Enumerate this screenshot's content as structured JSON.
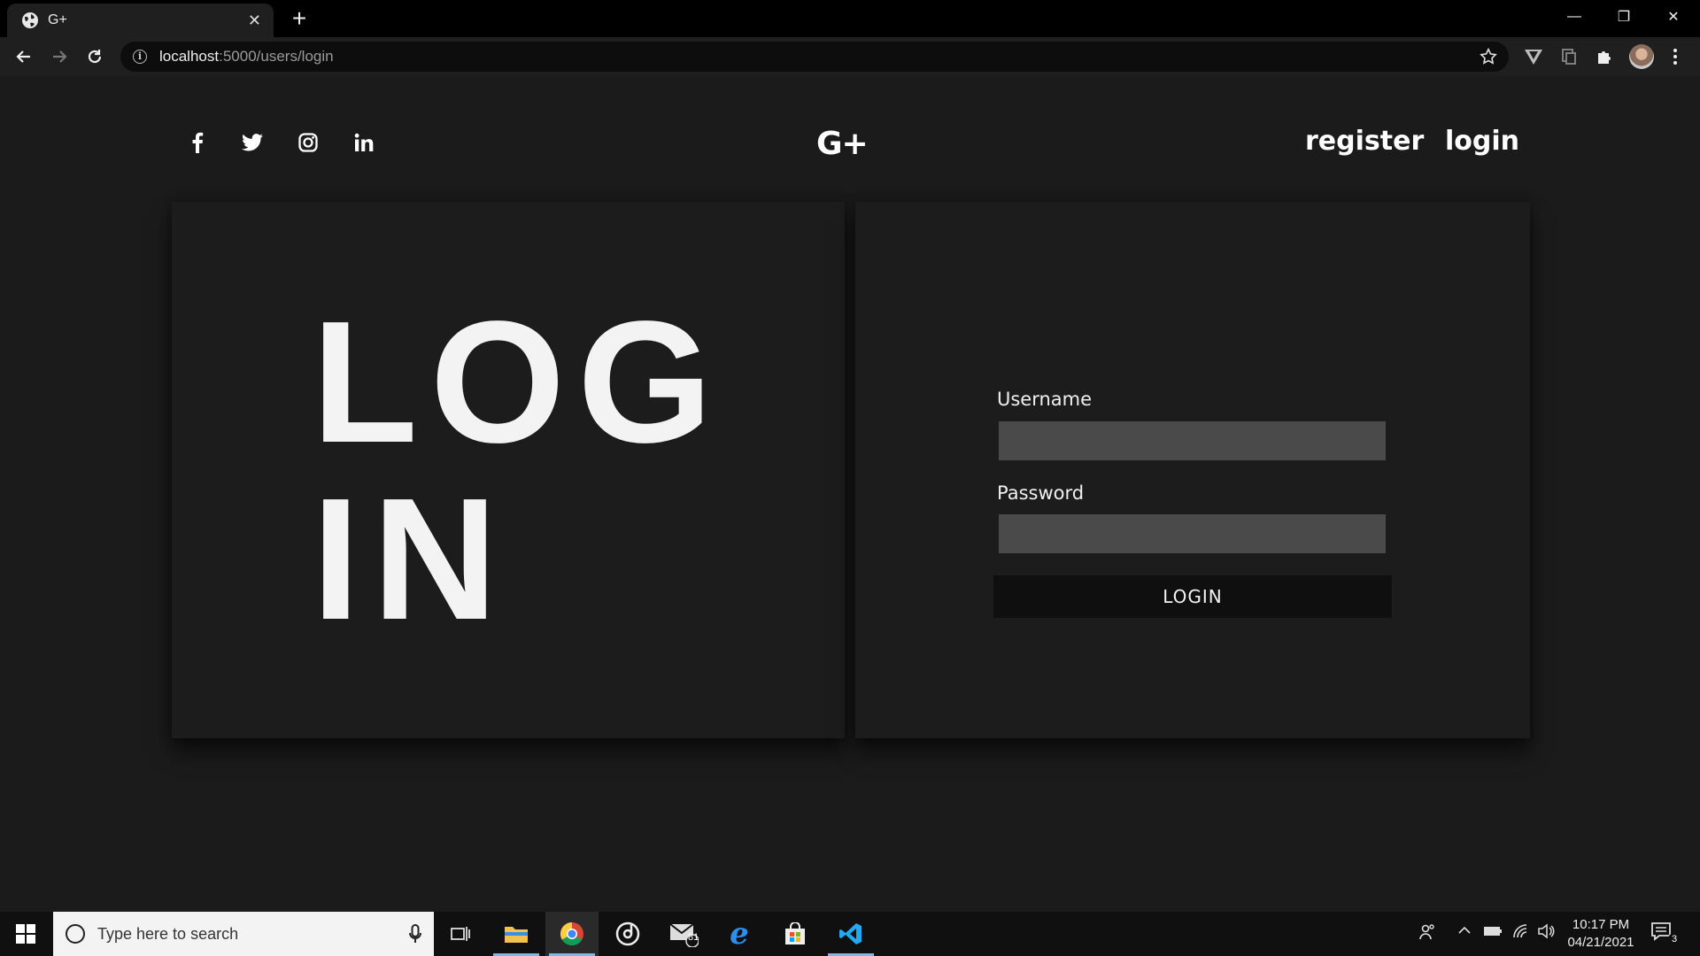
{
  "browser": {
    "tab_title": "G+",
    "tab_close": "✕",
    "new_tab": "+",
    "url_host": "localhost",
    "url_path": ":5000/users/login",
    "window_controls": {
      "minimize": "—",
      "restore": "❐",
      "close": "✕"
    }
  },
  "site": {
    "social": [
      "facebook",
      "twitter",
      "instagram",
      "linkedin"
    ],
    "logo": "G+",
    "nav": {
      "register": "register",
      "login": "login"
    }
  },
  "hero": {
    "line1": "LOG",
    "line2": "IN"
  },
  "form": {
    "username_label": "Username",
    "username_value": "",
    "password_label": "Password",
    "password_value": "",
    "submit_label": "LOGIN"
  },
  "taskbar": {
    "search_placeholder": "Type here to search",
    "mail_badge": "81",
    "time": "10:17 PM",
    "date": "04/21/2021",
    "notification_count": "3"
  },
  "colors": {
    "page_bg": "#1b1b1b",
    "card_bg": "#1c1c1c",
    "input_bg": "#4a4a4a",
    "button_bg": "#0f0f0f",
    "text": "#f3f3f3"
  }
}
